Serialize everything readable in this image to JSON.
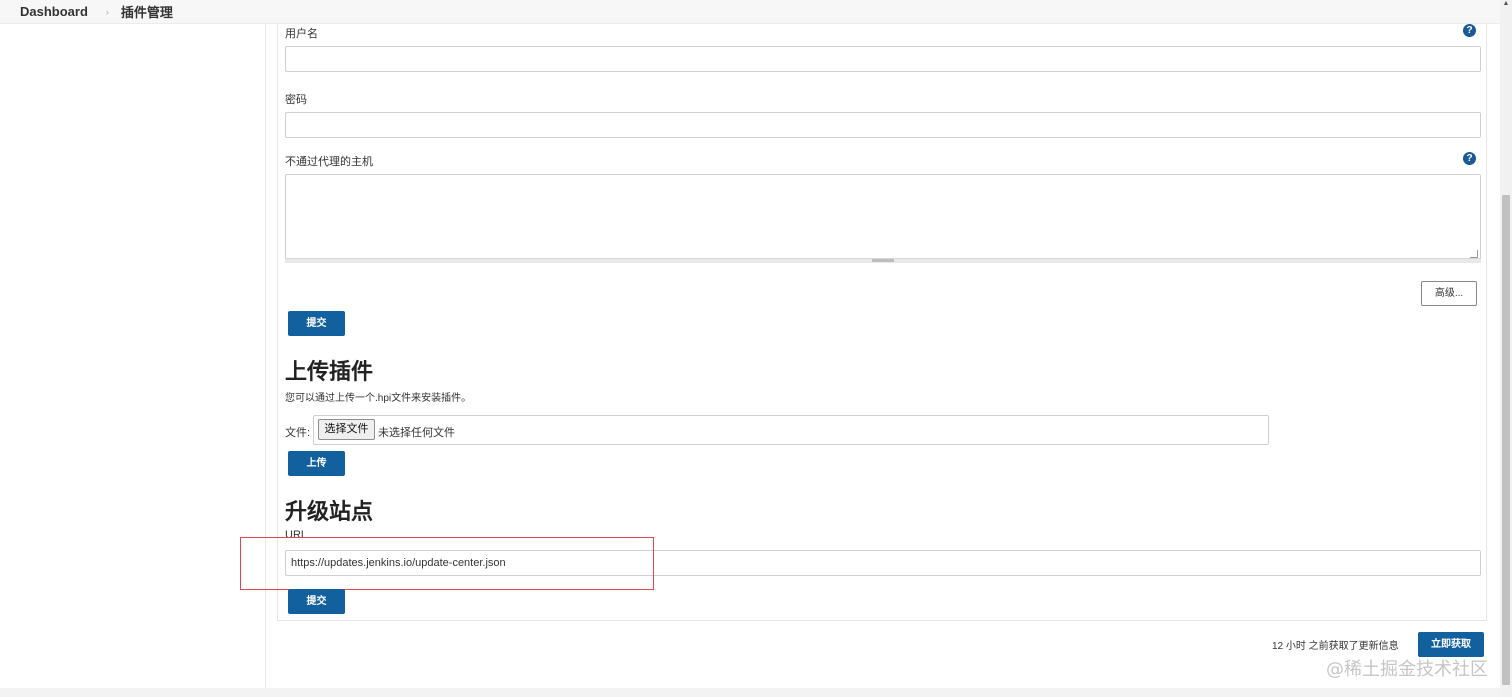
{
  "breadcrumb": {
    "root": "Dashboard",
    "separator": "›",
    "current": "插件管理"
  },
  "proxy": {
    "username_label": "用户名",
    "username_value": "",
    "password_label": "密码",
    "password_value": "",
    "no_proxy_label": "不通过代理的主机",
    "help_glyph": "?",
    "advanced_label": "高级...",
    "submit_label": "提交"
  },
  "upload": {
    "title": "上传插件",
    "description": "您可以通过上传一个.hpi文件来安装插件。",
    "file_label": "文件:",
    "choose_file_label": "选择文件",
    "no_file_text": "未选择任何文件",
    "upload_label": "上传"
  },
  "update_site": {
    "title": "升级站点",
    "url_label": "URL",
    "url_value": "https://updates.jenkins.io/update-center.json",
    "submit_label": "提交"
  },
  "footer": {
    "last_checked": "12 小时 之前获取了更新信息",
    "check_now_label": "立即获取",
    "watermark": "@稀土掘金技术社区"
  },
  "colors": {
    "primary_button": "#13609e",
    "help_icon": "#1a5a96",
    "highlight_box": "#e0464f"
  },
  "icons": {
    "help": "question-circle-icon",
    "separator": "chevron-right-icon",
    "scroll_up": "scroll-up-arrow-icon"
  }
}
